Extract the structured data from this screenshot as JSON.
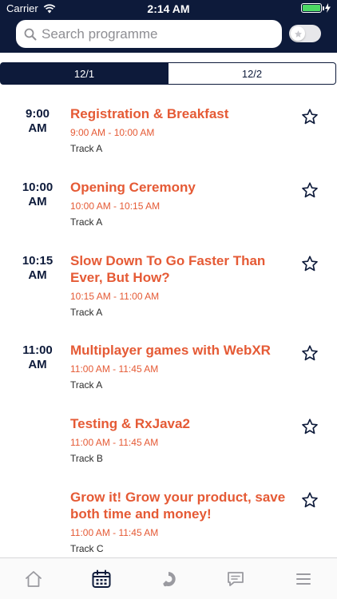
{
  "status": {
    "carrier": "Carrier",
    "time": "2:14 AM"
  },
  "search": {
    "placeholder": "Search programme"
  },
  "date_tabs": [
    {
      "label": "12/1",
      "active": true
    },
    {
      "label": "12/2",
      "active": false
    }
  ],
  "sessions": [
    {
      "time_top": "9:00",
      "time_bottom": "AM",
      "title": "Registration & Breakfast",
      "range": "9:00 AM - 10:00 AM",
      "track": "Track A"
    },
    {
      "time_top": "10:00",
      "time_bottom": "AM",
      "title": "Opening Ceremony",
      "range": "10:00 AM - 10:15 AM",
      "track": "Track A"
    },
    {
      "time_top": "10:15",
      "time_bottom": "AM",
      "title": "Slow Down To Go Faster Than Ever, But How?",
      "range": "10:15 AM - 11:00 AM",
      "track": "Track A"
    },
    {
      "time_top": "11:00",
      "time_bottom": "AM",
      "title": "Multiplayer games with WebXR",
      "range": "11:00 AM - 11:45 AM",
      "track": "Track A"
    },
    {
      "time_top": "",
      "time_bottom": "",
      "title": "Testing & RxJava2",
      "range": "11:00 AM - 11:45 AM",
      "track": "Track B"
    },
    {
      "time_top": "",
      "time_bottom": "",
      "title": "Grow it! Grow your product, save both time and money!",
      "range": "11:00 AM - 11:45 AM",
      "track": "Track C"
    }
  ],
  "tabbar": {
    "items": [
      {
        "icon": "home-icon",
        "active": false
      },
      {
        "icon": "calendar-icon",
        "active": true
      },
      {
        "icon": "logo-icon",
        "active": false
      },
      {
        "icon": "chat-icon",
        "active": false
      },
      {
        "icon": "menu-icon",
        "active": false
      }
    ]
  },
  "colors": {
    "navy": "#0d1a3a",
    "accent": "#e55a35",
    "icon_gray": "#8e8e93"
  }
}
